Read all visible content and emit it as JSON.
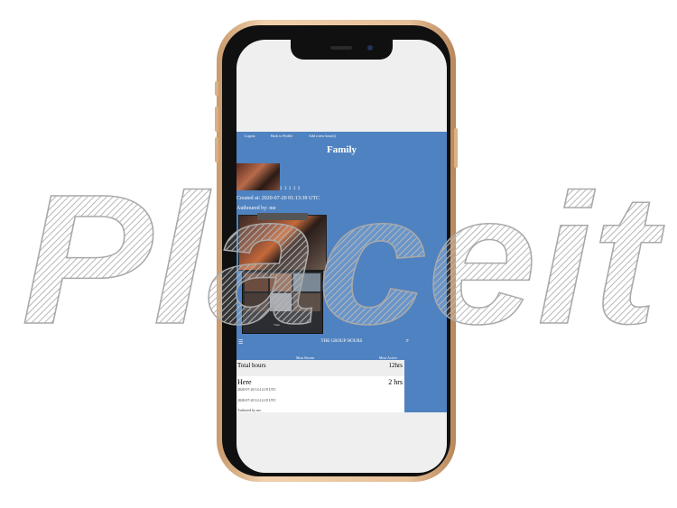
{
  "nav": {
    "logout": "Logout",
    "back": "Back to Profile",
    "add": "Add a new hour(s)"
  },
  "album": {
    "title": "Family",
    "pages": "2 3 2 3 2",
    "created": "Created at: 2020-07-20 01:13:39 UTC",
    "author": "Authoured by: me",
    "photo_caption": "Video"
  },
  "app": {
    "title": "THE GROUP HOURS"
  },
  "tabs": {
    "recent": "Most Recent",
    "active": "Most Active"
  },
  "summary": {
    "label": "Total hours",
    "value": "12hrs"
  },
  "entry": {
    "title": "Here",
    "hours": "2 hrs",
    "created": "2020-07-20 14:12:19 UTC",
    "updated": "2020-07-20 14:12:19 UTC",
    "author": "Authored by me"
  },
  "watermark": {
    "text": "Placeit"
  }
}
